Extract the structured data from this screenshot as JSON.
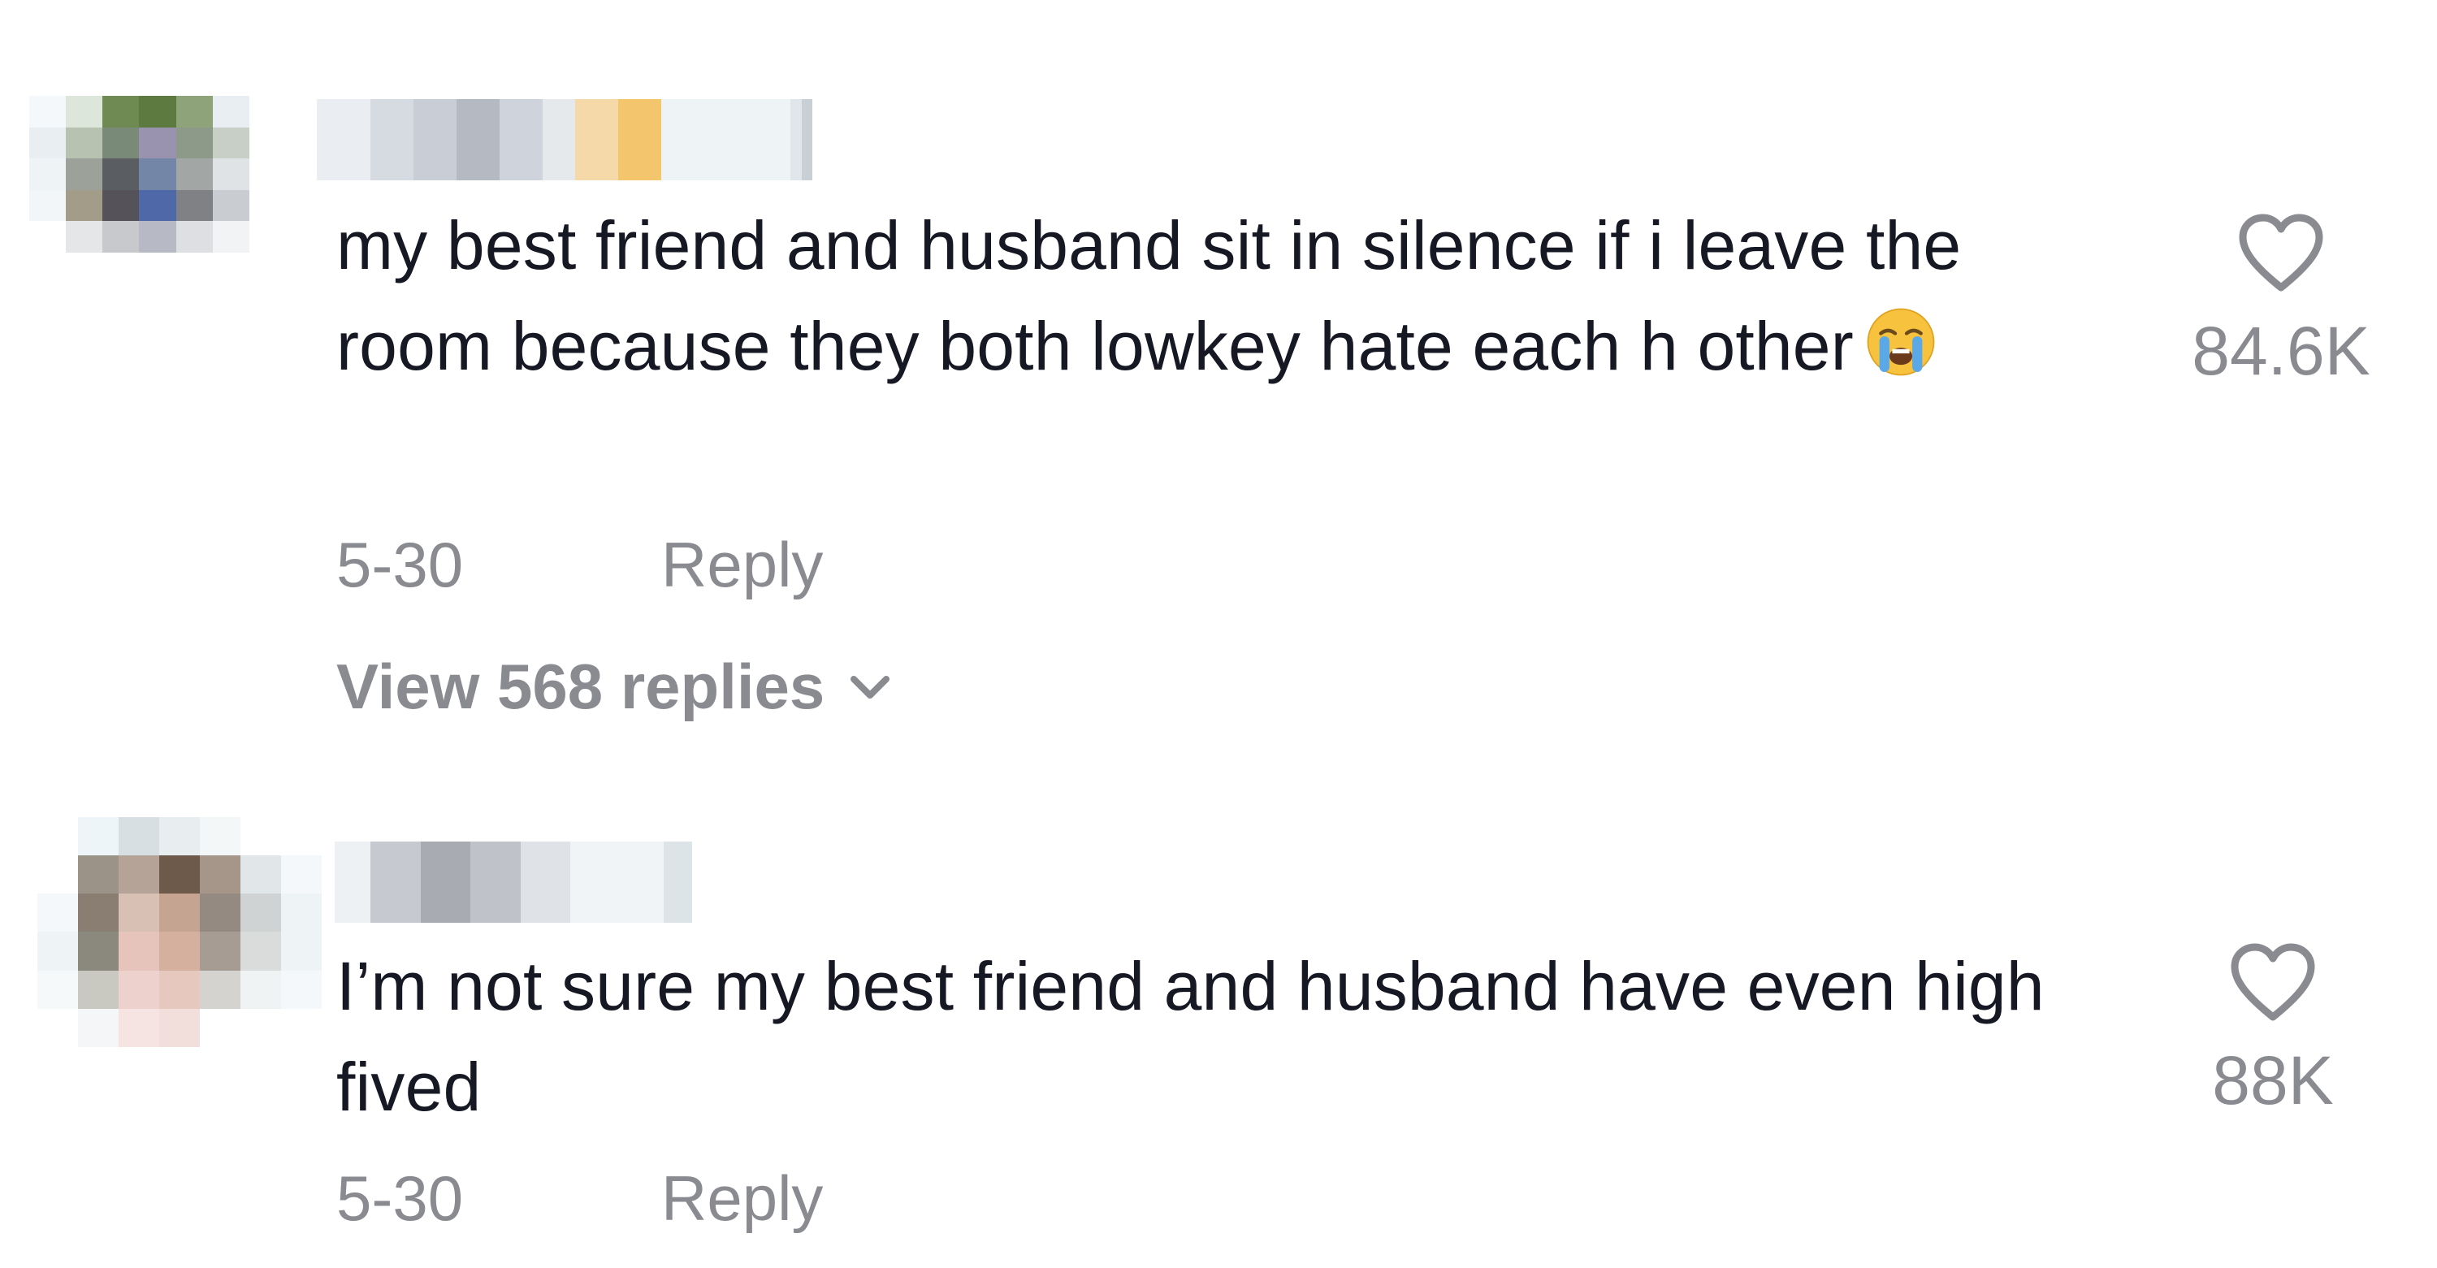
{
  "comments": [
    {
      "username": "",
      "text": "my best friend and husband sit in silence if i leave the room because they both lowkey hate each h other",
      "emoji": "loudly-crying-face",
      "date": "5-30",
      "reply_label": "Reply",
      "view_replies_label": "View 568 replies",
      "like_count": "84.6K"
    },
    {
      "username": "",
      "text": "I’m not sure my best friend and husband have even high fived",
      "date": "5-30",
      "reply_label": "Reply",
      "like_count": "88K"
    }
  ],
  "icons": {
    "heart": "heart-outline-icon",
    "chevron": "chevron-down-icon"
  },
  "colors": {
    "text_primary": "#161823",
    "text_secondary": "#8a8b91",
    "background": "#ffffff"
  }
}
